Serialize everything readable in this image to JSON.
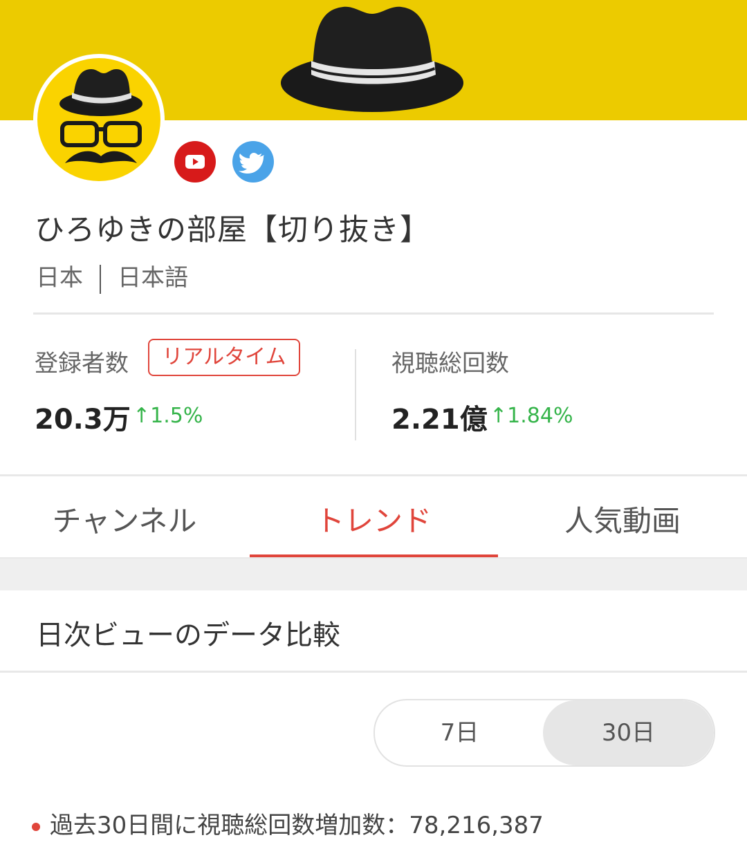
{
  "channel": {
    "name": "ひろゆきの部屋【切り抜き】",
    "country": "日本",
    "language": "日本語"
  },
  "social": {
    "youtube_icon": "youtube-icon",
    "twitter_icon": "twitter-icon"
  },
  "stats": {
    "subscribers": {
      "label": "登録者数",
      "badge": "リアルタイム",
      "value": "20.3万",
      "growth": "1.5%"
    },
    "views": {
      "label": "視聴総回数",
      "value": "2.21億",
      "growth": "1.84%"
    }
  },
  "tabs": [
    {
      "label": "チャンネル",
      "active": false
    },
    {
      "label": "トレンド",
      "active": true
    },
    {
      "label": "人気動画",
      "active": false
    }
  ],
  "section": {
    "title": "日次ビューのデータ比較",
    "range_options": [
      "7日",
      "30日"
    ],
    "selected_range": "30日",
    "summary_label": "過去30日間に視聴総回数増加数：",
    "summary_value": "78,216,387"
  },
  "colors": {
    "banner": "#eccb00",
    "accent": "#e0453b",
    "growth": "#35b44a",
    "youtube": "#d71a1a",
    "twitter": "#4aa3e8"
  }
}
